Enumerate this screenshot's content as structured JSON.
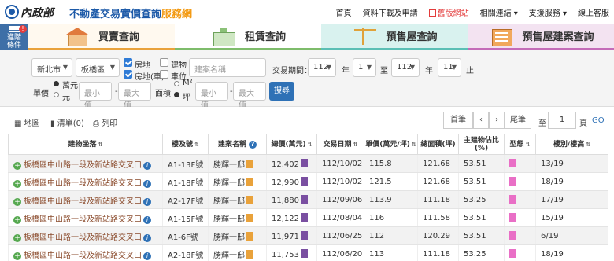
{
  "header": {
    "ministry": "內政部",
    "site_title_main": "不動產交易實價查詢",
    "site_title_accent": "服務網",
    "nav": [
      "首頁",
      "資料下載及申請",
      "舊版網站",
      "相關連結 ▾",
      "支援服務 ▾",
      "線上客服"
    ]
  },
  "sidebar_toggle": {
    "line1": "進階",
    "line2": "條件",
    "badge": "!"
  },
  "tabs": [
    "買賣查詢",
    "租賃查詢",
    "預售屋查詢",
    "預售屋建案查詢"
  ],
  "filters": {
    "city": "新北市",
    "district": "板橋區",
    "type_options": [
      "房地",
      "房地(車)",
      "建物",
      "車位"
    ],
    "project_placeholder": "建案名稱",
    "period_label": "交易期間：",
    "start_year": "112",
    "start_month": "1",
    "to_label": "至",
    "end_year": "112",
    "end_month": "11",
    "year_unit": "年",
    "end_suffix": "止",
    "price_label": "單價",
    "price_units": [
      "萬元",
      "元"
    ],
    "min_placeholder": "最小值",
    "max_placeholder": "最大值",
    "area_label": "面積",
    "area_units": [
      "M²",
      "坪"
    ],
    "search_button": "搜尋"
  },
  "toolbar": {
    "map": "地圖",
    "list": "清單(0)",
    "print": "列印",
    "first": "首筆",
    "prev": "‹",
    "next": "›",
    "last": "尾筆",
    "to_label": "至",
    "page_value": "1",
    "page_unit": "頁",
    "go": "GO"
  },
  "table": {
    "headers": [
      "建物坐落",
      "樓及號",
      "建案名稱",
      "總價(萬元)",
      "交易日期",
      "單價(萬元/坪)",
      "總面積(坪)",
      "主建物佔比(%)",
      "型態",
      "樓別/樓高"
    ],
    "rows": [
      {
        "address": "板橋區中山路一段及新站路交叉口",
        "unit": "A1-13F號",
        "project": "勝輝一邸",
        "total": "12,402",
        "date": "112/10/02",
        "unit_price": "115.8",
        "area": "121.68",
        "ratio": "53.51",
        "floor": "13/19"
      },
      {
        "address": "板橋區中山路一段及新站路交叉口",
        "unit": "A1-18F號",
        "project": "勝輝一邸",
        "total": "12,990",
        "date": "112/10/02",
        "unit_price": "121.5",
        "area": "121.68",
        "ratio": "53.51",
        "floor": "18/19"
      },
      {
        "address": "板橋區中山路一段及新站路交叉口",
        "unit": "A2-17F號",
        "project": "勝輝一邸",
        "total": "11,880",
        "date": "112/09/06",
        "unit_price": "113.9",
        "area": "111.18",
        "ratio": "53.25",
        "floor": "17/19"
      },
      {
        "address": "板橋區中山路一段及新站路交叉口",
        "unit": "A1-15F號",
        "project": "勝輝一邸",
        "total": "12,122",
        "date": "112/08/04",
        "unit_price": "116",
        "area": "111.58",
        "ratio": "53.51",
        "floor": "15/19"
      },
      {
        "address": "板橋區中山路一段及新站路交叉口",
        "unit": "A1-6F號",
        "project": "勝輝一邸",
        "total": "11,971",
        "date": "112/06/25",
        "unit_price": "112",
        "area": "120.29",
        "ratio": "53.51",
        "floor": "6/19"
      },
      {
        "address": "板橋區中山路一段及新站路交叉口",
        "unit": "A2-18F號",
        "project": "勝輝一邸",
        "total": "11,753",
        "date": "112/06/20",
        "unit_price": "113",
        "area": "111.18",
        "ratio": "53.25",
        "floor": "18/19"
      }
    ]
  },
  "colors": {
    "brand_blue": "#1d5aa8",
    "accent_orange": "#f39a12",
    "button_blue": "#2e71b6",
    "old_site_red": "#e33b3b"
  }
}
